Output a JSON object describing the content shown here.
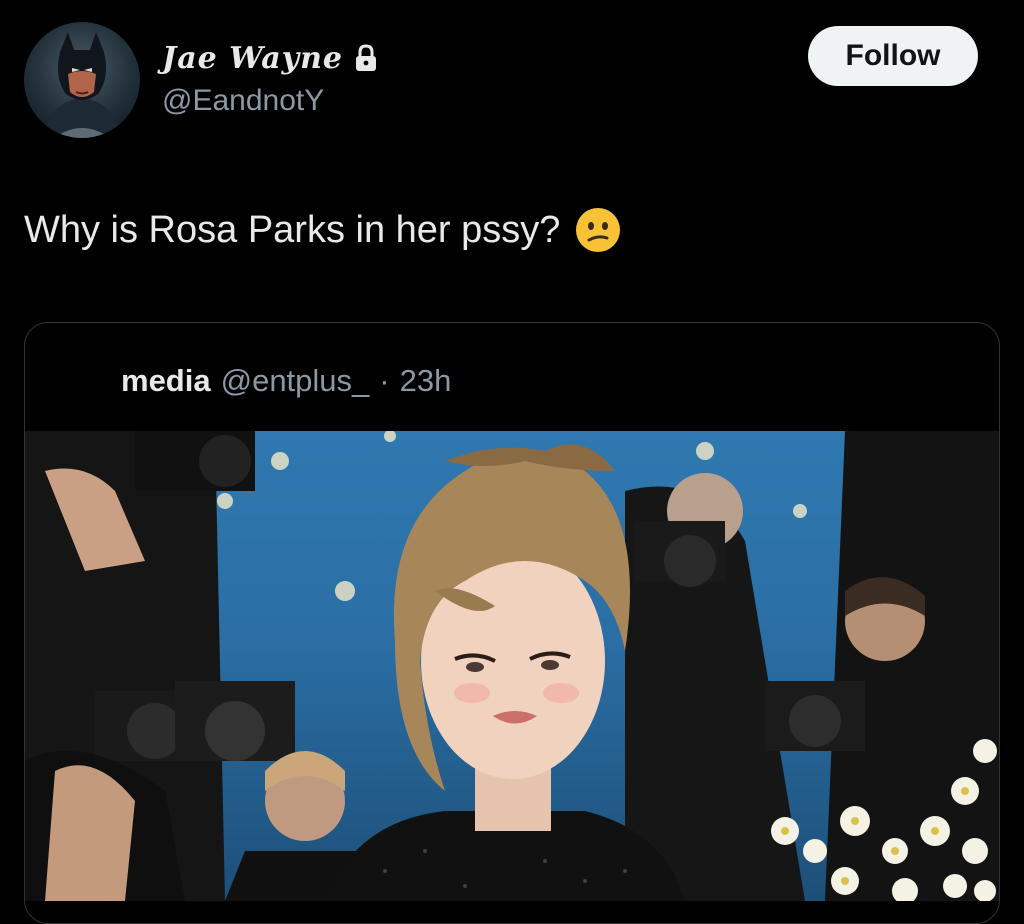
{
  "header": {
    "display_name": "Jae Wayne",
    "handle": "@EandnotY",
    "follow_label": "Follow",
    "avatar_icon": "batman-avatar-icon",
    "protected_icon": "lock-icon"
  },
  "tweet": {
    "text": "Why is Rosa Parks in her pssy?",
    "emoji": "confused-face-emoji"
  },
  "quoted": {
    "name": "media",
    "handle": "@entplus_",
    "separator": "·",
    "time": "23h",
    "media_icon": "photo-red-carpet-image"
  },
  "colors": {
    "background": "#000000",
    "text_primary": "#e7e9ea",
    "text_secondary": "#8b98a5",
    "follow_bg": "#eff3f4",
    "border": "#2f3336"
  }
}
